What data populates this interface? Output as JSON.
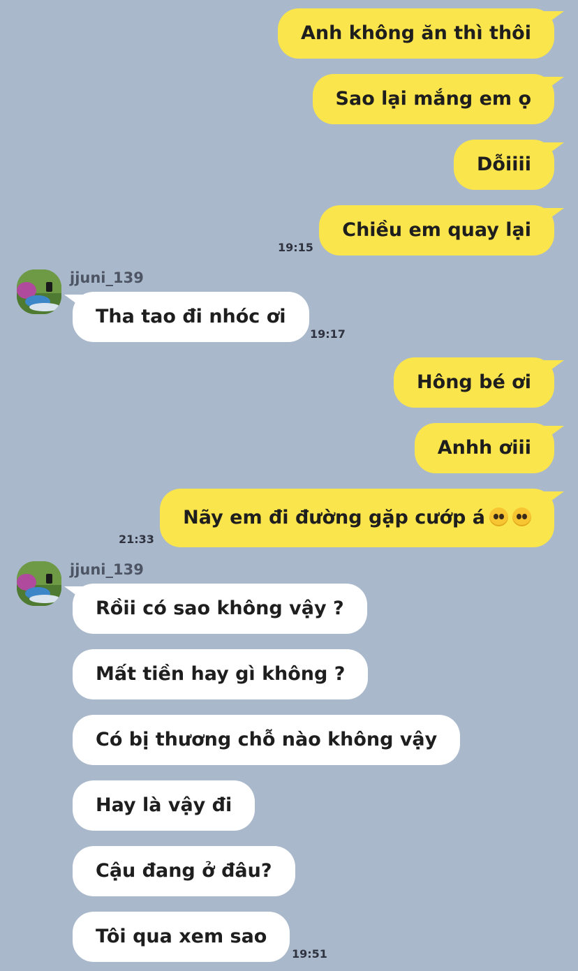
{
  "messages": {
    "m1": "Anh không ăn thì thôi",
    "m2": "Sao lại mắng em ọ",
    "m3": "Dỗiiii",
    "m4": "Chiều em quay lại",
    "m5": "Tha tao đi nhóc ơi",
    "m6": "Hông bé ơi",
    "m7": "Anhh ơiii",
    "m8": "Nãy em đi đường gặp cướp á",
    "m9": "Rồii có sao không vậy ?",
    "m10": "Mất tiền hay gì không ?",
    "m11": "Có bị thương chỗ nào không vậy",
    "m12": "Hay là vậy đi",
    "m13": "Cậu đang ở đâu?",
    "m14": "Tôi qua xem sao"
  },
  "times": {
    "t1": "19:15",
    "t2": "19:17",
    "t3": "21:33",
    "t4": "19:51"
  },
  "contact": {
    "username": "jjuni_139",
    "avatar": "profile-photo"
  },
  "emoji_icon": "pleading-face-emoji",
  "colors": {
    "background": "#a9b8cb",
    "outgoing_bubble": "#fbe54c",
    "incoming_bubble": "#ffffff"
  }
}
